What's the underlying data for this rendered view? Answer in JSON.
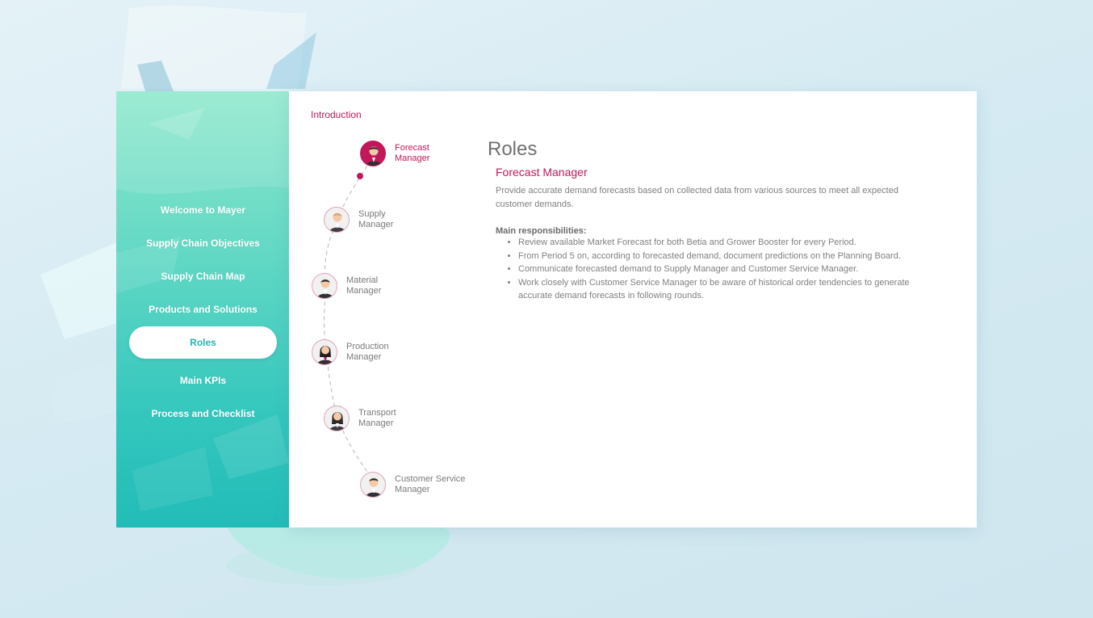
{
  "sidebar": {
    "items": [
      {
        "label": "Welcome to Mayer"
      },
      {
        "label": "Supply Chain Objectives"
      },
      {
        "label": "Supply Chain Map"
      },
      {
        "label": "Products and Solutions"
      },
      {
        "label": "Roles",
        "active": true
      },
      {
        "label": "Main KPIs"
      },
      {
        "label": "Process and Checklist"
      }
    ]
  },
  "main": {
    "breadcrumb": "Introduction",
    "roles": [
      {
        "line1": "Forecast",
        "line2": "Manager",
        "avatar": "male-manager-avatar",
        "active": true
      },
      {
        "line1": "Supply",
        "line2": "Manager",
        "avatar": "male-manager-avatar"
      },
      {
        "line1": "Material",
        "line2": "Manager",
        "avatar": "male-manager-avatar"
      },
      {
        "line1": "Production",
        "line2": "Manager",
        "avatar": "female-manager-avatar"
      },
      {
        "line1": "Transport",
        "line2": "Manager",
        "avatar": "female-manager-avatar"
      },
      {
        "line1": "Customer Service",
        "line2": "Manager",
        "avatar": "male-manager-avatar"
      }
    ],
    "content": {
      "title": "Roles",
      "role_title": "Forecast Manager",
      "description": "Provide accurate demand forecasts based on collected data from various sources to meet all expected customer demands.",
      "responsibilities_title": "Main responsibilities:",
      "responsibilities": [
        "Review available Market Forecast for both Betia and Grower Booster for every Period.",
        "From Period 5 on, according to forecasted demand, document predictions on the Planning Board.",
        "Communicate forecasted demand to Supply Manager and Customer Service Manager.",
        "Work closely with Customer Service Manager to be aware of historical order tendencies to generate accurate demand forecasts in following rounds."
      ]
    }
  },
  "colors": {
    "accent": "#c2185b",
    "sidebar_top": "#8fe8cc",
    "sidebar_bottom": "#22bcb8",
    "active_nav_text": "#2bb3b2"
  }
}
